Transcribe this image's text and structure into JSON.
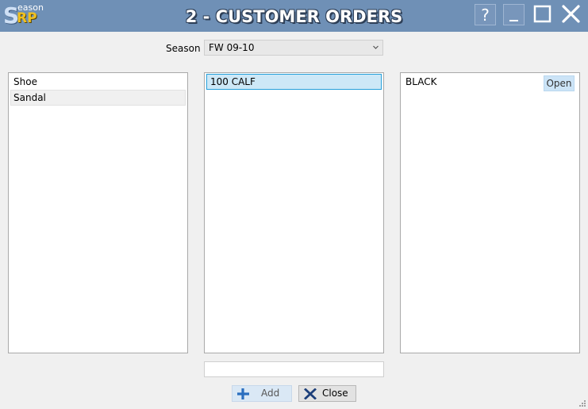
{
  "titlebar": {
    "logo_letter": "S",
    "logo_suffix": "eason",
    "logo_rp": "RP",
    "title": "2 - CUSTOMER ORDERS",
    "help_label": "?"
  },
  "filter": {
    "season_label": "Season",
    "season_value": "FW 09-10"
  },
  "list_types": {
    "items": [
      "Shoe",
      "Sandal"
    ]
  },
  "list_models": {
    "items": [
      "100 CALF"
    ],
    "selected_index": 0
  },
  "list_colors": {
    "items": [
      "BLACK"
    ],
    "open_label": "Open"
  },
  "footer": {
    "input_value": "",
    "add_label": "Add",
    "close_label": "Close"
  },
  "colors": {
    "titlebar": "#6f90b6",
    "selection": "#cde8f7",
    "selection_border": "#26a0da",
    "add_icon": "#2a6ebf",
    "close_icon": "#1d3f7a"
  }
}
